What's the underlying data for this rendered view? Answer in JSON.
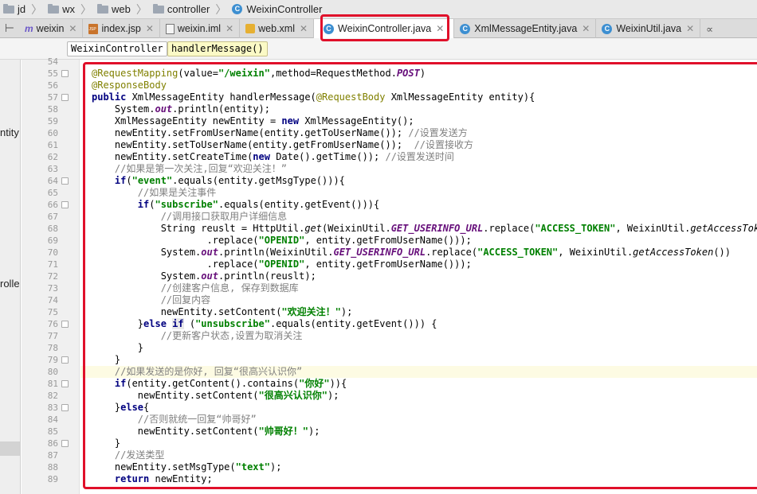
{
  "breadcrumb": {
    "items": [
      {
        "label": "jd",
        "icon": "folder-icon"
      },
      {
        "label": "wx",
        "icon": "folder-icon"
      },
      {
        "label": "web",
        "icon": "folder-icon"
      },
      {
        "label": "controller",
        "icon": "folder-icon"
      },
      {
        "label": "WeixinController",
        "icon": "class-icon"
      }
    ]
  },
  "tabs": [
    {
      "label": "weixin",
      "icon": "maven-module-icon",
      "active": false
    },
    {
      "label": "index.jsp",
      "icon": "jsp-file-icon",
      "active": false
    },
    {
      "label": "weixin.iml",
      "icon": "iml-file-icon",
      "active": false
    },
    {
      "label": "web.xml",
      "icon": "xml-file-icon",
      "active": false
    },
    {
      "label": "WeixinController.java",
      "icon": "class-icon",
      "active": true
    },
    {
      "label": "XmlMessageEntity.java",
      "icon": "class-icon",
      "active": false
    },
    {
      "label": "WeixinUtil.java",
      "icon": "class-icon",
      "active": false
    }
  ],
  "structure_breadcrumb": {
    "class_name": "WeixinController",
    "method_name": "handlerMessage()"
  },
  "left_panel": {
    "fragment_1": "ntity",
    "fragment_2": "rolle"
  },
  "highlight_color": "#e0102a",
  "code_line_numbers": [
    "54",
    "55",
    "56",
    "57",
    "58",
    "59",
    "60",
    "61",
    "62",
    "63",
    "64",
    "65",
    "66",
    "67",
    "68",
    "69",
    "70",
    "71",
    "72",
    "73",
    "74",
    "75",
    "76",
    "77",
    "78",
    "79",
    "80",
    "81",
    "82",
    "83",
    "84",
    "85",
    "86",
    "87",
    "88",
    "89"
  ],
  "current_line": "80",
  "code_lines": [
    [
      {
        "t": "        "
      }
    ],
    [
      {
        "t": "@RequestMapping",
        "c": "an"
      },
      {
        "t": "(value="
      },
      {
        "t": "\"/weixin\"",
        "c": "st"
      },
      {
        "t": ",method=RequestMethod."
      },
      {
        "t": "POST",
        "c": "sf"
      },
      {
        "t": ")"
      }
    ],
    [
      {
        "t": "@ResponseBody",
        "c": "an"
      }
    ],
    [
      {
        "t": "public ",
        "c": "kw"
      },
      {
        "t": "XmlMessageEntity handlerMessage("
      },
      {
        "t": "@RequestBody",
        "c": "an"
      },
      {
        "t": " XmlMessageEntity entity){"
      }
    ],
    [
      {
        "t": "    System."
      },
      {
        "t": "out",
        "c": "sf"
      },
      {
        "t": ".println(entity);"
      }
    ],
    [
      {
        "t": "    XmlMessageEntity newEntity = "
      },
      {
        "t": "new ",
        "c": "kw"
      },
      {
        "t": "XmlMessageEntity();"
      }
    ],
    [
      {
        "t": "    newEntity.setFromUserName(entity.getToUserName()); "
      },
      {
        "t": "//设置发送方",
        "c": "cm"
      }
    ],
    [
      {
        "t": "    newEntity.setToUserName(entity.getFromUserName());  "
      },
      {
        "t": "//设置接收方",
        "c": "cm"
      }
    ],
    [
      {
        "t": "    newEntity.setCreateTime("
      },
      {
        "t": "new ",
        "c": "kw"
      },
      {
        "t": "Date().getTime()); "
      },
      {
        "t": "//设置发送时间",
        "c": "cm"
      }
    ],
    [
      {
        "t": "    "
      },
      {
        "t": "//如果是第一次关注,回复“欢迎关注！”",
        "c": "cm"
      }
    ],
    [
      {
        "t": "    "
      },
      {
        "t": "if",
        "c": "kw"
      },
      {
        "t": "("
      },
      {
        "t": "\"event\"",
        "c": "st"
      },
      {
        "t": ".equals(entity.getMsgType())){"
      }
    ],
    [
      {
        "t": "        "
      },
      {
        "t": "//如果是关注事件",
        "c": "cm"
      }
    ],
    [
      {
        "t": "        "
      },
      {
        "t": "if",
        "c": "kw"
      },
      {
        "t": "("
      },
      {
        "t": "\"subscribe\"",
        "c": "st"
      },
      {
        "t": ".equals(entity.getEvent())){"
      }
    ],
    [
      {
        "t": "            "
      },
      {
        "t": "//调用接口获取用户详细信息",
        "c": "cm"
      }
    ],
    [
      {
        "t": "            String reuslt = HttpUtil."
      },
      {
        "t": "get",
        "c": "it"
      },
      {
        "t": "(WeixinUtil."
      },
      {
        "t": "GET_USERINFO_URL",
        "c": "sf"
      },
      {
        "t": ".replace("
      },
      {
        "t": "\"ACCESS_TOKEN\"",
        "c": "st"
      },
      {
        "t": ", WeixinUtil."
      },
      {
        "t": "getAccessToken",
        "c": "it"
      },
      {
        "t": "("
      }
    ],
    [
      {
        "t": "                    .replace("
      },
      {
        "t": "\"OPENID\"",
        "c": "st"
      },
      {
        "t": ", entity.getFromUserName()));"
      }
    ],
    [
      {
        "t": "            System."
      },
      {
        "t": "out",
        "c": "sf"
      },
      {
        "t": ".println(WeixinUtil."
      },
      {
        "t": "GET_USERINFO_URL",
        "c": "sf"
      },
      {
        "t": ".replace("
      },
      {
        "t": "\"ACCESS_TOKEN\"",
        "c": "st"
      },
      {
        "t": ", WeixinUtil."
      },
      {
        "t": "getAccessToken",
        "c": "it"
      },
      {
        "t": "())"
      }
    ],
    [
      {
        "t": "                    .replace("
      },
      {
        "t": "\"OPENID\"",
        "c": "st"
      },
      {
        "t": ", entity.getFromUserName()));"
      }
    ],
    [
      {
        "t": "            System."
      },
      {
        "t": "out",
        "c": "sf"
      },
      {
        "t": ".println(reuslt);"
      }
    ],
    [
      {
        "t": "            "
      },
      {
        "t": "//创建客户信息, 保存到数据库",
        "c": "cm"
      }
    ],
    [
      {
        "t": "            "
      },
      {
        "t": "//回复内容",
        "c": "cm"
      }
    ],
    [
      {
        "t": "            newEntity.setContent("
      },
      {
        "t": "\"欢迎关注！\"",
        "c": "st"
      },
      {
        "t": ");"
      }
    ],
    [
      {
        "t": "        }"
      },
      {
        "t": "else ",
        "c": "kw"
      },
      {
        "t": "if",
        "c": "kw hi"
      },
      {
        "t": " ("
      },
      {
        "t": "\"unsubscribe\"",
        "c": "st"
      },
      {
        "t": ".equals(entity.getEvent())) {"
      }
    ],
    [
      {
        "t": "            "
      },
      {
        "t": "//更新客户状态,设置为取消关注",
        "c": "cm"
      }
    ],
    [
      {
        "t": "        }"
      }
    ],
    [
      {
        "t": "    }"
      }
    ],
    [
      {
        "t": "    "
      },
      {
        "t": "//如果发送的是你好, 回复“很高兴认识你”",
        "c": "cm"
      }
    ],
    [
      {
        "t": "    "
      },
      {
        "t": "if",
        "c": "kw"
      },
      {
        "t": "(entity.getContent().contains("
      },
      {
        "t": "\"你好\"",
        "c": "st"
      },
      {
        "t": ")){"
      }
    ],
    [
      {
        "t": "        newEntity.setContent("
      },
      {
        "t": "\"很高兴认识你\"",
        "c": "st"
      },
      {
        "t": ");"
      }
    ],
    [
      {
        "t": "    }"
      },
      {
        "t": "else",
        "c": "kw"
      },
      {
        "t": "{"
      }
    ],
    [
      {
        "t": "        "
      },
      {
        "t": "//否则就统一回复“帅哥好”",
        "c": "cm"
      }
    ],
    [
      {
        "t": "        newEntity.setContent("
      },
      {
        "t": "\"帅哥好！\"",
        "c": "st"
      },
      {
        "t": ");"
      }
    ],
    [
      {
        "t": "    }"
      }
    ],
    [
      {
        "t": "    "
      },
      {
        "t": "//发送类型",
        "c": "cm"
      }
    ],
    [
      {
        "t": "    newEntity.setMsgType("
      },
      {
        "t": "\"text\"",
        "c": "st"
      },
      {
        "t": ");"
      }
    ],
    [
      {
        "t": "    "
      },
      {
        "t": "return ",
        "c": "kw"
      },
      {
        "t": "newEntity;"
      }
    ]
  ]
}
